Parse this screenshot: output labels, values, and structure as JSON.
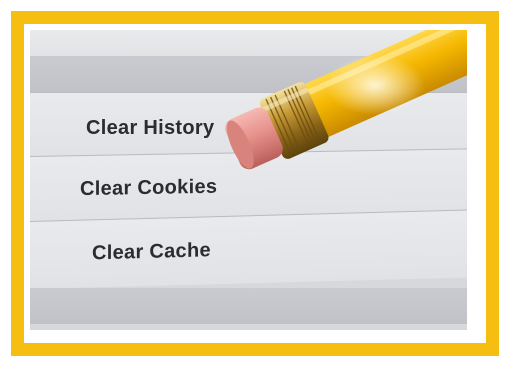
{
  "menu": {
    "items": [
      {
        "label": "Clear History"
      },
      {
        "label": "Clear Cookies"
      },
      {
        "label": "Clear Cache"
      }
    ]
  },
  "colors": {
    "frame": "#f7be12",
    "pencil_body": "#f4b400",
    "eraser": "#e8948f",
    "ferrule": "#b38a2a"
  },
  "icons": {
    "pencil": "pencil-eraser-icon"
  }
}
